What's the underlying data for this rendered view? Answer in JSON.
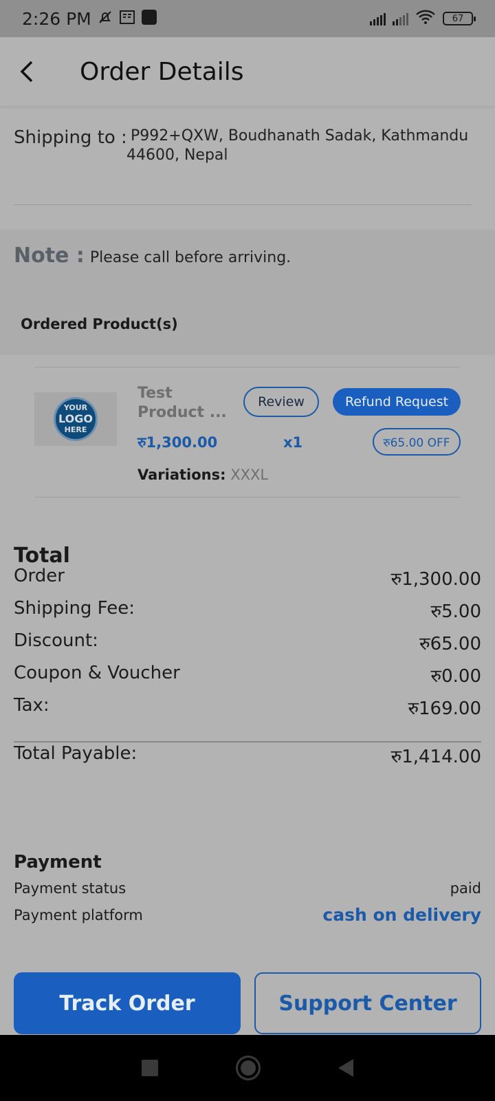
{
  "status_bar": {
    "time": "2:26 PM",
    "battery": "67"
  },
  "header": {
    "title": "Order Details"
  },
  "shipping": {
    "label": "Shipping to :",
    "address": "P992+QXW, Boudhanath Sadak, Kathmandu 44600, Nepal"
  },
  "note": {
    "label": "Note :",
    "text": "Please call before arriving."
  },
  "ordered_products": {
    "title": "Ordered Product(s)",
    "items": [
      {
        "image_text": [
          "YOUR",
          "LOGO",
          "HERE"
        ],
        "name": "Test Product ...",
        "price": "रु1,300.00",
        "quantity": "x1",
        "review_label": "Review",
        "refund_label": "Refund Request",
        "discount_badge": "रु65.00 OFF",
        "variations_label": "Variations:",
        "variations_value": "XXXL"
      }
    ]
  },
  "totals": {
    "title": "Total",
    "rows": [
      {
        "label": "Order",
        "value": "रु1,300.00"
      },
      {
        "label": "Shipping Fee:",
        "value": "रु5.00"
      },
      {
        "label": "Discount:",
        "value": "रु65.00"
      },
      {
        "label": "Coupon & Voucher",
        "value": "रु0.00"
      },
      {
        "label": "Tax:",
        "value": "रु169.00"
      }
    ],
    "payable_label": "Total Payable:",
    "payable_value": "रु1,414.00"
  },
  "payment": {
    "title": "Payment",
    "status_label": "Payment status",
    "status_value": "paid",
    "platform_label": "Payment platform",
    "platform_value": "cash on delivery"
  },
  "actions": {
    "track_label": "Track Order",
    "support_label": "Support Center"
  },
  "colors": {
    "accent": "#1a5ec0",
    "accent_text": "#1a5aa8"
  }
}
